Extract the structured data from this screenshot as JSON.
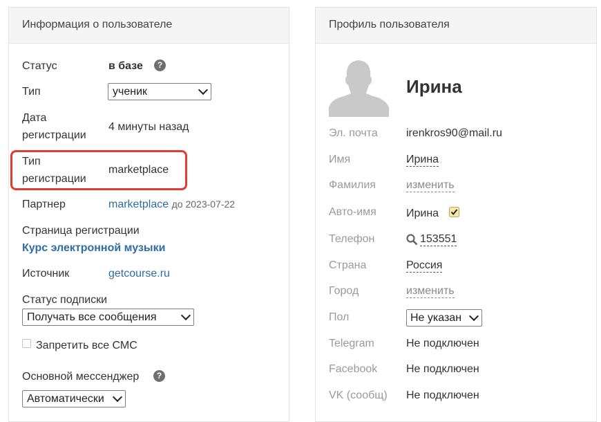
{
  "left_panel": {
    "title": "Информация о пользователе",
    "status_label": "Статус",
    "status_value": "в базе",
    "type_label": "Тип",
    "type_value": "ученик",
    "regdate_label_1": "Дата",
    "regdate_label_2": "регистрации",
    "regdate_value": "4 минуты назад",
    "regtype_label_1": "Тип",
    "regtype_label_2": "регистрации",
    "regtype_value": "marketplace",
    "partner_label": "Партнер",
    "partner_link": "marketplace",
    "partner_until": "до 2023-07-22",
    "regpage_label": "Страница регистрации",
    "regpage_link": "Курс электронной музыки",
    "source_label": "Источник",
    "source_link": "getcourse.ru",
    "subscription_label": "Статус подписки",
    "subscription_value": "Получать все сообщения",
    "no_sms_label": "Запретить все СМС",
    "messenger_label": "Основной мессенджер",
    "messenger_value": "Автоматически",
    "help_glyph": "?"
  },
  "right_panel": {
    "title": "Профиль пользователя",
    "name_heading": "Ирина",
    "email_label": "Эл. почта",
    "email_value": "irenkros90@mail.ru",
    "first_name_label": "Имя",
    "first_name_value": "Ирина",
    "last_name_label": "Фамилия",
    "last_name_value": "изменить",
    "autoname_label": "Авто-имя",
    "autoname_value": "Ирина",
    "phone_label": "Телефон",
    "phone_value": "153551",
    "country_label": "Страна",
    "country_value": "Россия",
    "city_label": "Город",
    "city_value": "изменить",
    "gender_label": "Пол",
    "gender_value": "Не указан",
    "telegram_label": "Telegram",
    "telegram_value": "Не подключен",
    "facebook_label": "Facebook",
    "facebook_value": "Не подключен",
    "vk_label": "VK (сообщ)",
    "vk_value": "Не подключен"
  },
  "colors": {
    "link": "#2e6da4",
    "highlight": "#e03c31",
    "header_bg": "#f5f5f5",
    "checkbox_checked": "#f7e9a8"
  },
  "icons": [
    "help-icon",
    "chevron-down-icon",
    "search-icon",
    "checkmark-icon",
    "avatar-placeholder"
  ]
}
